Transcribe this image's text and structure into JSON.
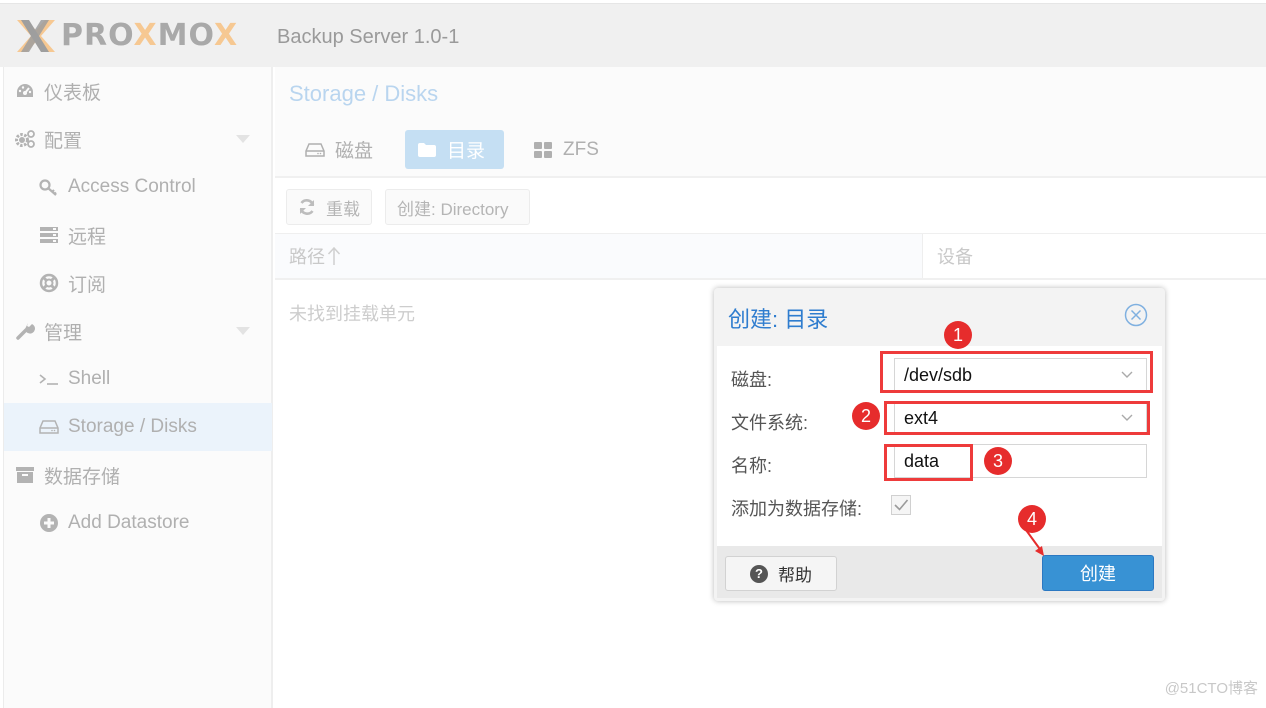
{
  "header": {
    "logo_prefix": "PR",
    "logo_o1": "O",
    "logo_mid": "",
    "logo_brand": "PROXMOX",
    "product": "Backup Server 1.0-1",
    "colors": {
      "logo_gray": "#a9a9a9",
      "logo_orange": "#f6c892"
    }
  },
  "sidebar": {
    "items": [
      {
        "label": "仪表板",
        "icon": "dashboard-icon",
        "level": "top"
      },
      {
        "label": "配置",
        "icon": "gears-icon",
        "level": "top",
        "expandable": true
      },
      {
        "label": "Access Control",
        "icon": "key-icon",
        "level": "sub"
      },
      {
        "label": "远程",
        "icon": "server-icon",
        "level": "sub"
      },
      {
        "label": "订阅",
        "icon": "support-icon",
        "level": "sub"
      },
      {
        "label": "管理",
        "icon": "wrench-icon",
        "level": "top",
        "expandable": true
      },
      {
        "label": "Shell",
        "icon": "terminal-icon",
        "level": "sub"
      },
      {
        "label": "Storage / Disks",
        "icon": "hdd-icon",
        "level": "sub",
        "selected": true
      },
      {
        "label": "数据存储",
        "icon": "archive-icon",
        "level": "top"
      },
      {
        "label": "Add Datastore",
        "icon": "plus-circle-icon",
        "level": "sub"
      }
    ]
  },
  "main": {
    "title": "Storage / Disks",
    "tabs": [
      {
        "label": "磁盘",
        "icon": "hdd-icon"
      },
      {
        "label": "目录",
        "icon": "folder-icon",
        "active": true
      },
      {
        "label": "ZFS",
        "icon": "grid-icon"
      }
    ],
    "toolbar": {
      "reload_label": "重载",
      "create_label": "创建: Directory"
    },
    "grid": {
      "columns": [
        {
          "label": "路径",
          "sort": "asc"
        },
        {
          "label": "设备"
        }
      ],
      "empty_text": "未找到挂载单元"
    }
  },
  "dialog": {
    "title": "创建: 目录",
    "fields": {
      "disk": {
        "label": "磁盘:",
        "value": "/dev/sdb"
      },
      "filesystem": {
        "label": "文件系统:",
        "value": "ext4"
      },
      "name": {
        "label": "名称:",
        "value": "data"
      },
      "add_datastore": {
        "label": "添加为数据存储:",
        "checked": true
      }
    },
    "help_label": "帮助",
    "create_label": "创建",
    "colors": {
      "title": "#2f7dcf",
      "primary_button": "#3892d4"
    }
  },
  "annotations": {
    "badges": [
      "1",
      "2",
      "3",
      "4"
    ],
    "color": "#e62c2c"
  },
  "watermark": "@51CTO博客"
}
